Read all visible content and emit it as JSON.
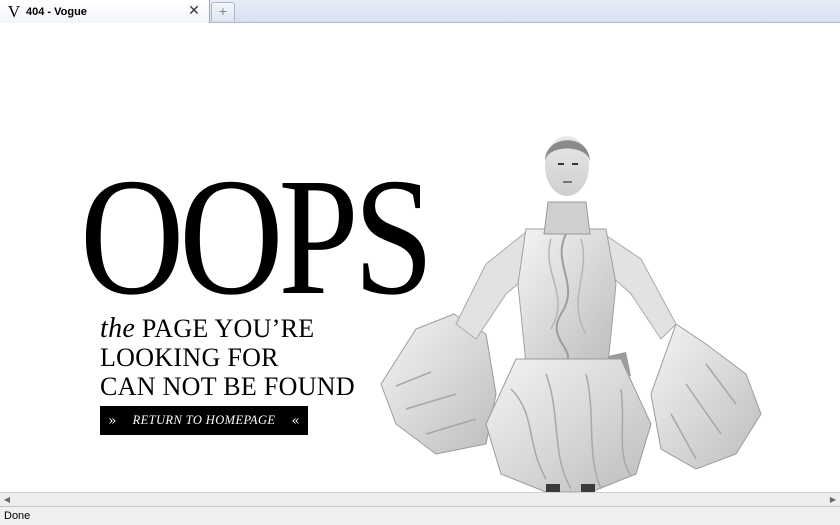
{
  "browser": {
    "tab": {
      "favicon_letter": "V",
      "title": "404 - Vogue",
      "close_glyph": "✕"
    },
    "new_tab_glyph": "+"
  },
  "page": {
    "headline": "OOPS",
    "message": {
      "line1_italic": "the",
      "line1_rest": " PAGE YOU’RE",
      "line2": "LOOKING FOR",
      "line3": "CAN NOT BE FOUND"
    },
    "return_button": {
      "left_chevron": "»",
      "label": "RETURN TO HOMEPAGE",
      "right_chevron": "«"
    },
    "hero_image": "model-in-white-ruffled-dress"
  },
  "scrollbar": {
    "left_arrow": "◀",
    "right_arrow": "▶"
  },
  "status": {
    "text": "Done"
  },
  "colors": {
    "page_background": "#ffffff",
    "text": "#000000",
    "button_background": "#000000",
    "button_text": "#ffffff"
  }
}
